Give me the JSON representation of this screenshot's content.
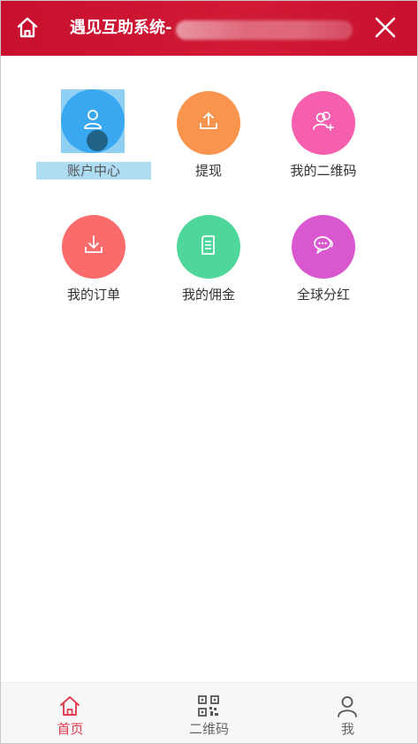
{
  "header": {
    "title": "遇见互助系统-",
    "home_icon": "home-icon",
    "close_icon": "close-icon",
    "background_color": "#c8102e"
  },
  "menu": {
    "items": [
      {
        "label": "账户中心",
        "icon": "user-icon",
        "color": "#3aa8f0",
        "selected": true
      },
      {
        "label": "提现",
        "icon": "upload-icon",
        "color": "#f9944e"
      },
      {
        "label": "我的二维码",
        "icon": "add-user-icon",
        "color": "#f55fae"
      },
      {
        "label": "我的订单",
        "icon": "download-icon",
        "color": "#fa6b6b"
      },
      {
        "label": "我的佣金",
        "icon": "document-icon",
        "color": "#4fd69a"
      },
      {
        "label": "全球分红",
        "icon": "chat-icon",
        "color": "#d958d0"
      }
    ]
  },
  "bottom_nav": {
    "items": [
      {
        "label": "首页",
        "icon": "home-icon",
        "active": true
      },
      {
        "label": "二维码",
        "icon": "qr-code-icon",
        "active": false
      },
      {
        "label": "我",
        "icon": "user-icon",
        "active": false
      }
    ],
    "active_color": "#e23a4f"
  }
}
